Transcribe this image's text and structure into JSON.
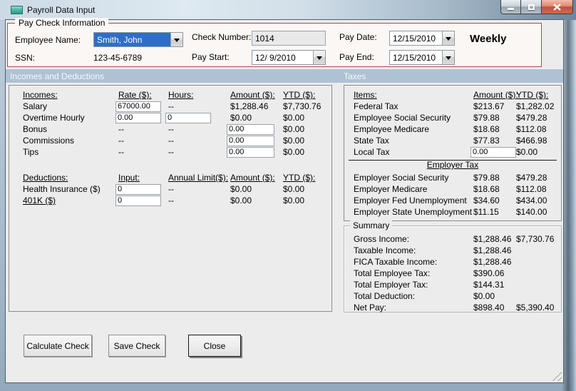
{
  "window": {
    "title": "Payroll Data Input"
  },
  "paycheck_info": {
    "group_title": "Pay Check Information",
    "fields": {
      "employee_name": {
        "label": "Employee Name:",
        "value": "Smith, John"
      },
      "ssn": {
        "label": "SSN:",
        "value": "123-45-6789"
      },
      "check_number": {
        "label": "Check Number:",
        "value": "1014"
      },
      "pay_start": {
        "label": "Pay Start:",
        "value": "12/ 9/2010"
      },
      "pay_date": {
        "label": "Pay Date:",
        "value": "12/15/2010"
      },
      "pay_end": {
        "label": "Pay End:",
        "value": "12/15/2010"
      }
    },
    "frequency": "Weekly"
  },
  "section_headers": {
    "incomes_deductions": "Incomes and Deductions",
    "taxes": "Taxes"
  },
  "incomes": {
    "headers": {
      "name": "Incomes:",
      "rate": "Rate ($):",
      "hours": "Hours:",
      "amount": "Amount ($):",
      "ytd": "YTD ($):"
    },
    "rows": [
      {
        "name": "Salary",
        "rate": "67000.00",
        "hours": "--",
        "amount": "$1,288.46",
        "ytd": "$7,730.76"
      },
      {
        "name": "Overtime Hourly",
        "rate": "0.00",
        "hours": "0",
        "amount": "$0.00",
        "ytd": "$0.00"
      },
      {
        "name": "Bonus",
        "rate": "--",
        "hours": "--",
        "amount": "0.00",
        "ytd": "$0.00"
      },
      {
        "name": "Commissions",
        "rate": "--",
        "hours": "--",
        "amount": "0.00",
        "ytd": "$0.00"
      },
      {
        "name": "Tips",
        "rate": "--",
        "hours": "--",
        "amount": "0.00",
        "ytd": "$0.00"
      }
    ]
  },
  "deductions": {
    "headers": {
      "name": "Deductions:",
      "input": "Input:",
      "limit": "Annual Limit($):",
      "amount": "Amount ($):",
      "ytd": "YTD ($):"
    },
    "rows": [
      {
        "name": "Health Insurance ($)",
        "input": "0",
        "limit": "--",
        "amount": "$0.00",
        "ytd": "$0.00"
      },
      {
        "name": "401K ($)",
        "input": "0",
        "limit": "--",
        "amount": "$0.00",
        "ytd": "$0.00"
      }
    ]
  },
  "taxes": {
    "headers": {
      "item": "Items:",
      "amount": "Amount ($):",
      "ytd": "YTD ($):"
    },
    "employee_rows": [
      {
        "item": "Federal Tax",
        "amount": "$213.67",
        "ytd": "$1,282.02"
      },
      {
        "item": "Employee Social Security",
        "amount": "$79.88",
        "ytd": "$479.28"
      },
      {
        "item": "Employee Medicare",
        "amount": "$18.68",
        "ytd": "$112.08"
      },
      {
        "item": "State Tax",
        "amount": "$77.83",
        "ytd": "$466.98"
      },
      {
        "item": "Local Tax",
        "amount": "0.00",
        "ytd": "$0.00"
      }
    ],
    "employer_header": "Employer Tax",
    "employer_rows": [
      {
        "item": "Employer Social Security",
        "amount": "$79.88",
        "ytd": "$479.28"
      },
      {
        "item": "Employer Medicare",
        "amount": "$18.68",
        "ytd": "$112.08"
      },
      {
        "item": "Employer Fed Unemployment",
        "amount": "$34.60",
        "ytd": "$434.00"
      },
      {
        "item": "Employer State Unemployment",
        "amount": "$11.15",
        "ytd": "$140.00"
      }
    ]
  },
  "summary": {
    "group_title": "Summary",
    "rows": [
      {
        "label": "Gross Income:",
        "amount": "$1,288.46",
        "ytd": "$7,730.76"
      },
      {
        "label": "Taxable Income:",
        "amount": "$1,288.46",
        "ytd": ""
      },
      {
        "label": "FICA Taxable Income:",
        "amount": "$1,288.46",
        "ytd": ""
      },
      {
        "label": "Total Employee Tax:",
        "amount": "$390.06",
        "ytd": ""
      },
      {
        "label": "Total Employer Tax:",
        "amount": "$144.31",
        "ytd": ""
      },
      {
        "label": "Total Deduction:",
        "amount": "$0.00",
        "ytd": ""
      },
      {
        "label": "Net Pay:",
        "amount": "$898.40",
        "ytd": "$5,390.40"
      }
    ]
  },
  "buttons": {
    "calculate": "Calculate Check",
    "save": "Save Check",
    "close": "Close"
  },
  "colors": {
    "group_border": "#AC4B45",
    "section_header_bg": "#AFC2D3",
    "selection_bg": "#2F6EC6",
    "close_button_red": "#C2523A",
    "client_bg": "#ECECEC"
  }
}
